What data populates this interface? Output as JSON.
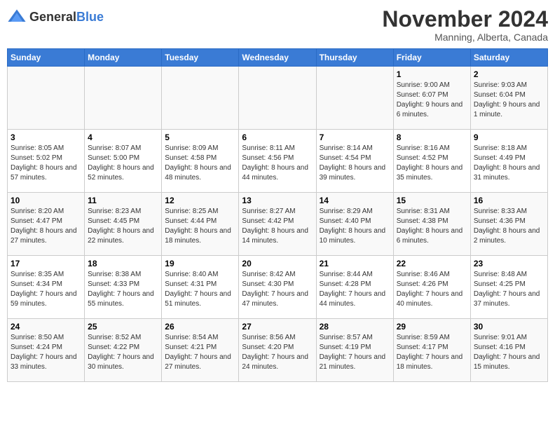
{
  "header": {
    "logo_general": "General",
    "logo_blue": "Blue",
    "month_title": "November 2024",
    "location": "Manning, Alberta, Canada"
  },
  "weekdays": [
    "Sunday",
    "Monday",
    "Tuesday",
    "Wednesday",
    "Thursday",
    "Friday",
    "Saturday"
  ],
  "weeks": [
    [
      {
        "day": "",
        "info": ""
      },
      {
        "day": "",
        "info": ""
      },
      {
        "day": "",
        "info": ""
      },
      {
        "day": "",
        "info": ""
      },
      {
        "day": "",
        "info": ""
      },
      {
        "day": "1",
        "info": "Sunrise: 9:00 AM\nSunset: 6:07 PM\nDaylight: 9 hours and 6 minutes."
      },
      {
        "day": "2",
        "info": "Sunrise: 9:03 AM\nSunset: 6:04 PM\nDaylight: 9 hours and 1 minute."
      }
    ],
    [
      {
        "day": "3",
        "info": "Sunrise: 8:05 AM\nSunset: 5:02 PM\nDaylight: 8 hours and 57 minutes."
      },
      {
        "day": "4",
        "info": "Sunrise: 8:07 AM\nSunset: 5:00 PM\nDaylight: 8 hours and 52 minutes."
      },
      {
        "day": "5",
        "info": "Sunrise: 8:09 AM\nSunset: 4:58 PM\nDaylight: 8 hours and 48 minutes."
      },
      {
        "day": "6",
        "info": "Sunrise: 8:11 AM\nSunset: 4:56 PM\nDaylight: 8 hours and 44 minutes."
      },
      {
        "day": "7",
        "info": "Sunrise: 8:14 AM\nSunset: 4:54 PM\nDaylight: 8 hours and 39 minutes."
      },
      {
        "day": "8",
        "info": "Sunrise: 8:16 AM\nSunset: 4:52 PM\nDaylight: 8 hours and 35 minutes."
      },
      {
        "day": "9",
        "info": "Sunrise: 8:18 AM\nSunset: 4:49 PM\nDaylight: 8 hours and 31 minutes."
      }
    ],
    [
      {
        "day": "10",
        "info": "Sunrise: 8:20 AM\nSunset: 4:47 PM\nDaylight: 8 hours and 27 minutes."
      },
      {
        "day": "11",
        "info": "Sunrise: 8:23 AM\nSunset: 4:45 PM\nDaylight: 8 hours and 22 minutes."
      },
      {
        "day": "12",
        "info": "Sunrise: 8:25 AM\nSunset: 4:44 PM\nDaylight: 8 hours and 18 minutes."
      },
      {
        "day": "13",
        "info": "Sunrise: 8:27 AM\nSunset: 4:42 PM\nDaylight: 8 hours and 14 minutes."
      },
      {
        "day": "14",
        "info": "Sunrise: 8:29 AM\nSunset: 4:40 PM\nDaylight: 8 hours and 10 minutes."
      },
      {
        "day": "15",
        "info": "Sunrise: 8:31 AM\nSunset: 4:38 PM\nDaylight: 8 hours and 6 minutes."
      },
      {
        "day": "16",
        "info": "Sunrise: 8:33 AM\nSunset: 4:36 PM\nDaylight: 8 hours and 2 minutes."
      }
    ],
    [
      {
        "day": "17",
        "info": "Sunrise: 8:35 AM\nSunset: 4:34 PM\nDaylight: 7 hours and 59 minutes."
      },
      {
        "day": "18",
        "info": "Sunrise: 8:38 AM\nSunset: 4:33 PM\nDaylight: 7 hours and 55 minutes."
      },
      {
        "day": "19",
        "info": "Sunrise: 8:40 AM\nSunset: 4:31 PM\nDaylight: 7 hours and 51 minutes."
      },
      {
        "day": "20",
        "info": "Sunrise: 8:42 AM\nSunset: 4:30 PM\nDaylight: 7 hours and 47 minutes."
      },
      {
        "day": "21",
        "info": "Sunrise: 8:44 AM\nSunset: 4:28 PM\nDaylight: 7 hours and 44 minutes."
      },
      {
        "day": "22",
        "info": "Sunrise: 8:46 AM\nSunset: 4:26 PM\nDaylight: 7 hours and 40 minutes."
      },
      {
        "day": "23",
        "info": "Sunrise: 8:48 AM\nSunset: 4:25 PM\nDaylight: 7 hours and 37 minutes."
      }
    ],
    [
      {
        "day": "24",
        "info": "Sunrise: 8:50 AM\nSunset: 4:24 PM\nDaylight: 7 hours and 33 minutes."
      },
      {
        "day": "25",
        "info": "Sunrise: 8:52 AM\nSunset: 4:22 PM\nDaylight: 7 hours and 30 minutes."
      },
      {
        "day": "26",
        "info": "Sunrise: 8:54 AM\nSunset: 4:21 PM\nDaylight: 7 hours and 27 minutes."
      },
      {
        "day": "27",
        "info": "Sunrise: 8:56 AM\nSunset: 4:20 PM\nDaylight: 7 hours and 24 minutes."
      },
      {
        "day": "28",
        "info": "Sunrise: 8:57 AM\nSunset: 4:19 PM\nDaylight: 7 hours and 21 minutes."
      },
      {
        "day": "29",
        "info": "Sunrise: 8:59 AM\nSunset: 4:17 PM\nDaylight: 7 hours and 18 minutes."
      },
      {
        "day": "30",
        "info": "Sunrise: 9:01 AM\nSunset: 4:16 PM\nDaylight: 7 hours and 15 minutes."
      }
    ]
  ]
}
